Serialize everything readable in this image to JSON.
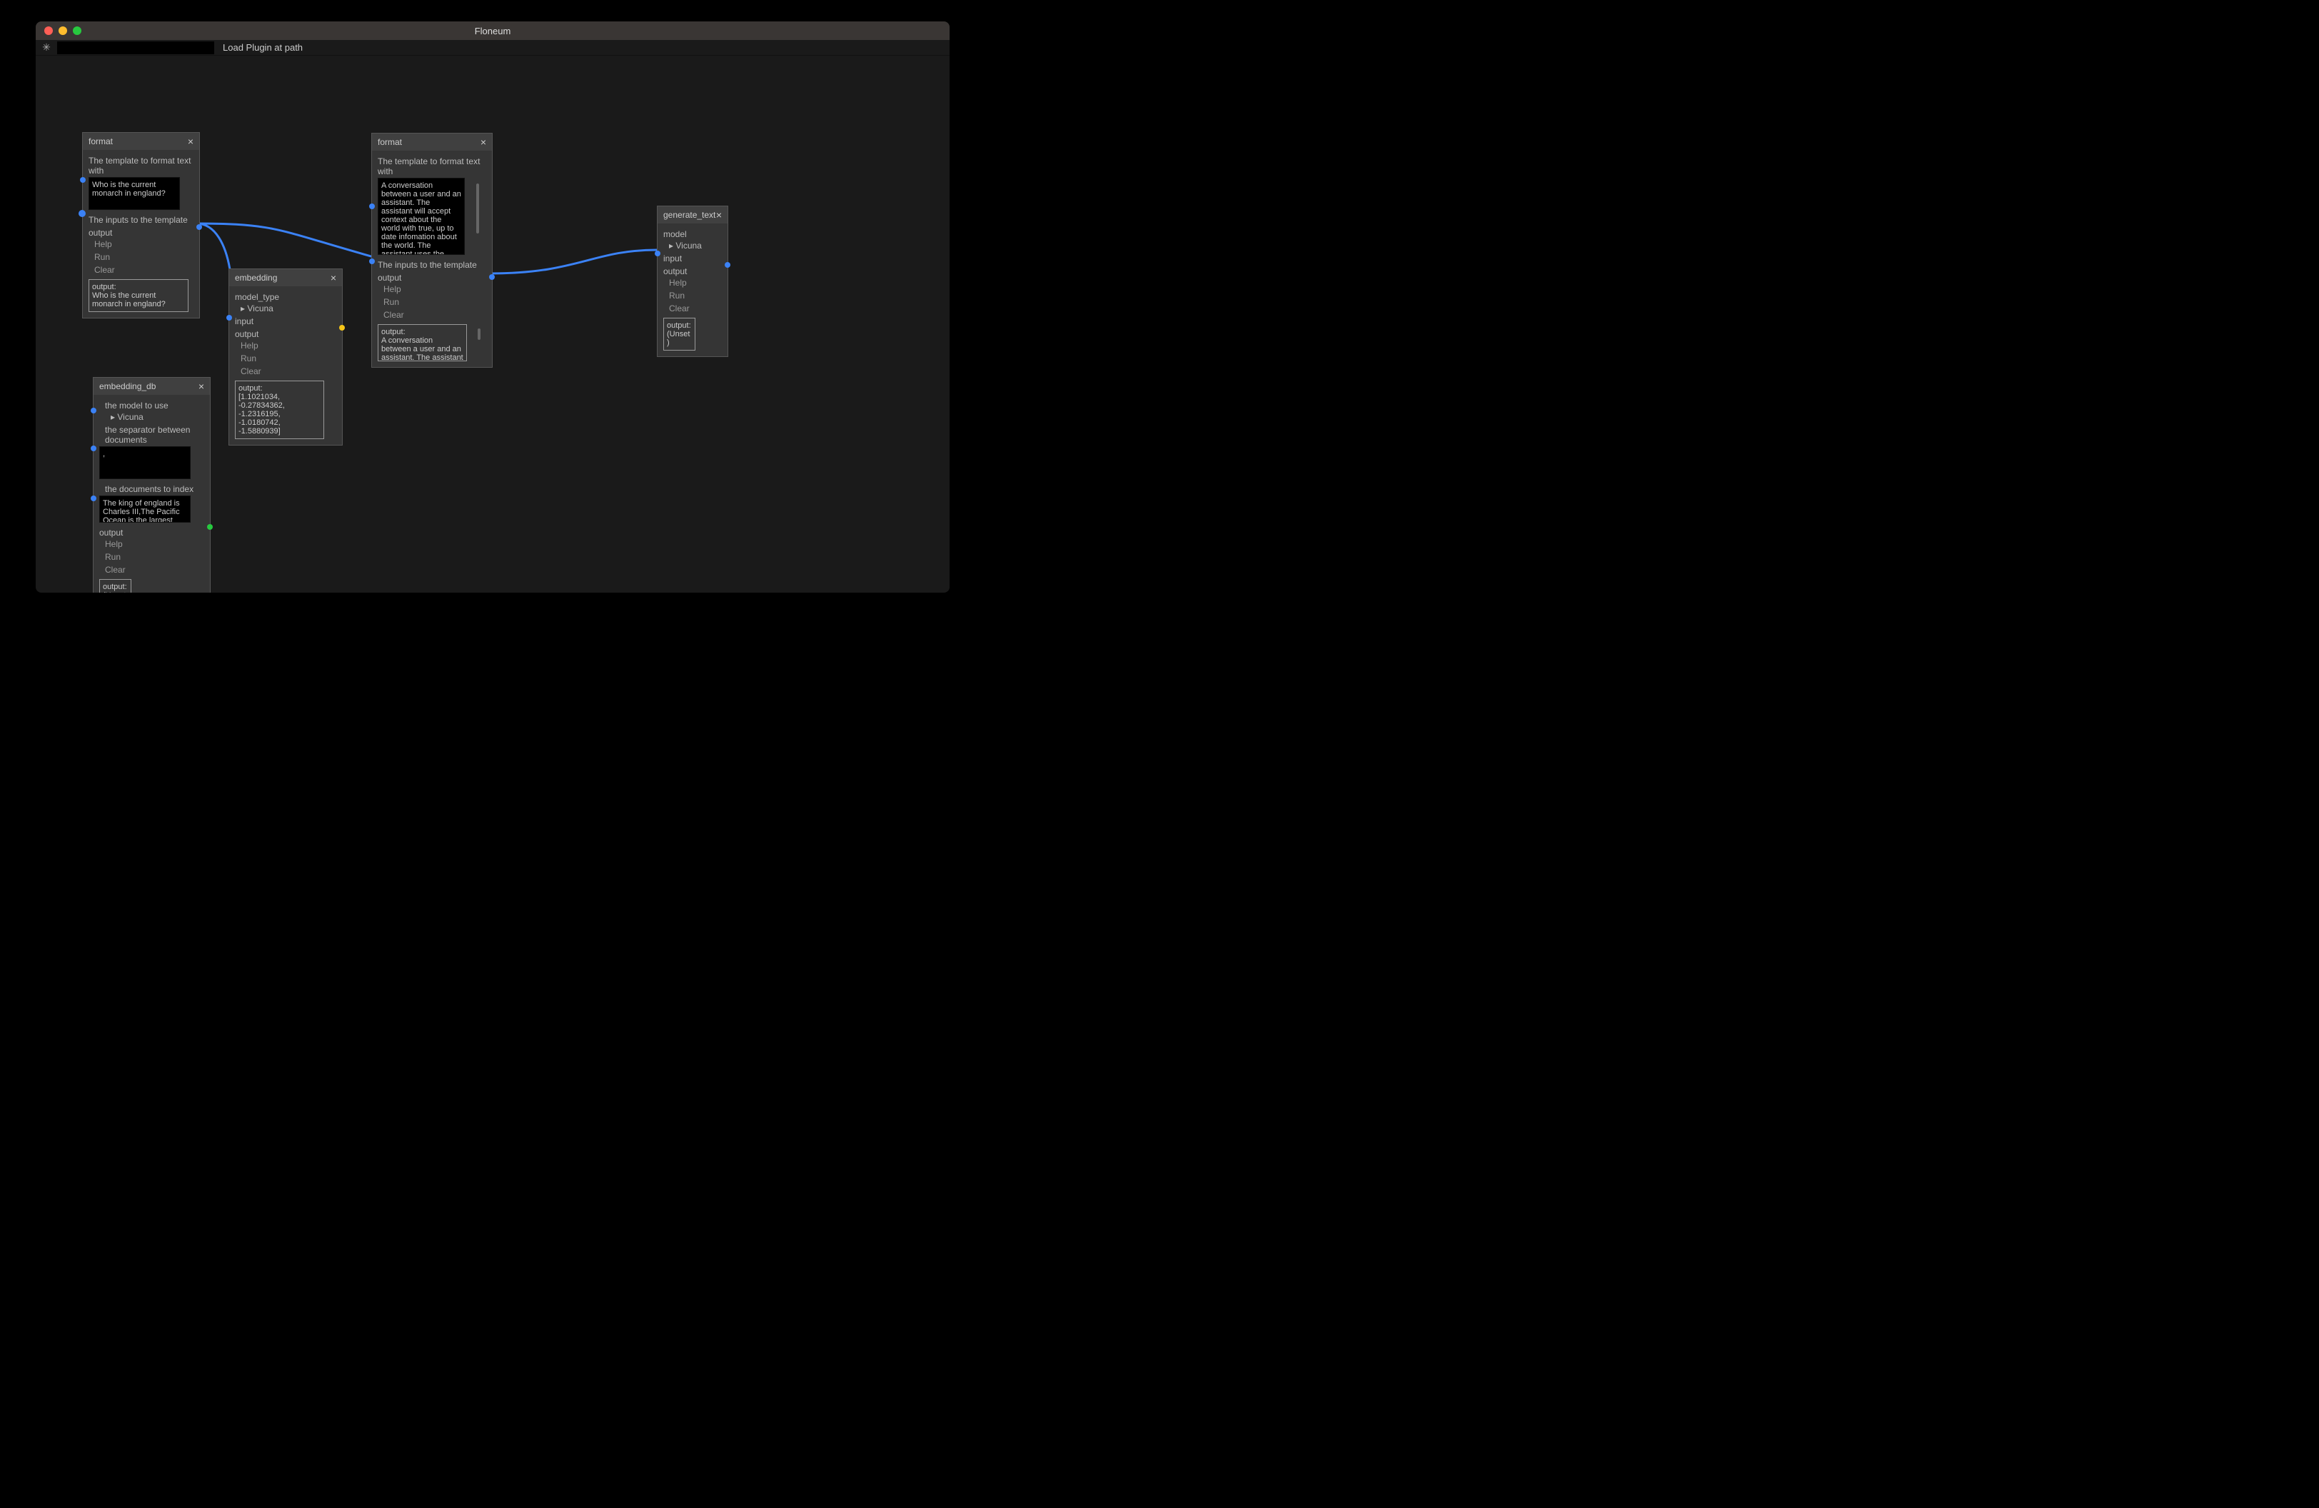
{
  "window": {
    "title": "Floneum"
  },
  "toolbar": {
    "star": "✳",
    "load_plugin_label": "Load Plugin at path"
  },
  "common": {
    "help": "Help",
    "run": "Run",
    "clear": "Clear",
    "output_label": "output",
    "output_prefix": "output:",
    "unset": "(Unset)",
    "close": "×",
    "dropdown_arrow": "▸"
  },
  "nodes": {
    "format1": {
      "title": "format",
      "template_label": "The template to format text with",
      "template_value": "Who is the current monarch in england?",
      "inputs_label": "The inputs to the template",
      "output_text": "Who is the current monarch in england?"
    },
    "embedding": {
      "title": "embedding",
      "model_type_label": "model_type",
      "model_value": "Vicuna",
      "input_label": "input",
      "output_text": "[1.1021034, -0.27834362, -1.2316195, -1.0180742, -1.5880939]"
    },
    "embedding_db": {
      "title": "embedding_db",
      "model_label": "the model to use",
      "model_value": "Vicuna",
      "separator_label": "the separator between documents",
      "separator_value": ",",
      "docs_label": "the documents to index",
      "docs_value": "The king of england is Charles III,The Pacific Ocean is the largest ocean which covers"
    },
    "format2": {
      "title": "format",
      "template_label": "The template to format text with",
      "template_value": "A conversation between a user and an assistant. The assistant will accept context about the world with true, up to date infomation about the world. The assistant uses the infomation in the context to answer susinctly:",
      "inputs_label": "The inputs to the template",
      "output_text": "A conversation between a user and an assistant. The assistant will accept"
    },
    "generate_text": {
      "title": "generate_text",
      "model_label": "model",
      "model_value": "Vicuna",
      "input_label": "input"
    }
  }
}
